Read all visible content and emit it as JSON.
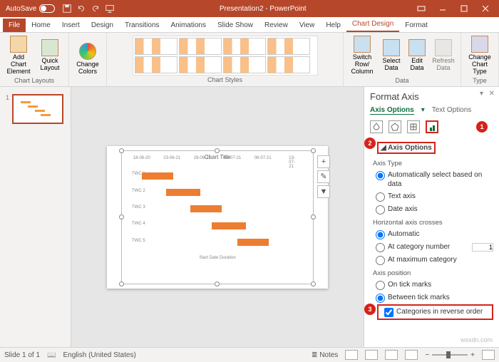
{
  "titlebar": {
    "autosave": "AutoSave",
    "title": "Presentation2 - PowerPoint"
  },
  "tabs": {
    "file": "File",
    "home": "Home",
    "insert": "Insert",
    "design": "Design",
    "transitions": "Transitions",
    "animations": "Animations",
    "slideshow": "Slide Show",
    "review": "Review",
    "view": "View",
    "help": "Help",
    "chartdesign": "Chart Design",
    "format": "Format"
  },
  "ribbon": {
    "layouts": {
      "addel": "Add Chart Element",
      "quick": "Quick Layout",
      "group": "Chart Layouts"
    },
    "colors": {
      "label": "Change Colors"
    },
    "styles_group": "Chart Styles",
    "data": {
      "switch": "Switch Row/ Column",
      "select": "Select Data",
      "edit": "Edit Data",
      "refresh": "Refresh Data",
      "group": "Data"
    },
    "type": {
      "change": "Change Chart Type",
      "group": "Type"
    }
  },
  "chart": {
    "title": "Chart Title",
    "legend": "Start Date   Duration"
  },
  "chart_data": {
    "type": "bar",
    "orientation": "horizontal",
    "categories": [
      "TWC 1",
      "TWC 2",
      "TWC 3",
      "TWC 4",
      "TWC 5"
    ],
    "x_ticks": [
      "18-06-20",
      "23-06-21",
      "28-06-21",
      "03-07-21",
      "08-07-21",
      "13-07-21"
    ],
    "bars": [
      {
        "left": 12,
        "width": 44
      },
      {
        "left": 46,
        "width": 48
      },
      {
        "left": 80,
        "width": 44
      },
      {
        "left": 110,
        "width": 48
      },
      {
        "left": 146,
        "width": 44
      }
    ],
    "title": "Chart Title"
  },
  "pane": {
    "title": "Format Axis",
    "tab1": "Axis Options",
    "tab2": "Text Options",
    "axis_options": "Axis Options",
    "axis_type": "Axis Type",
    "auto": "Automatically select based on data",
    "text_axis": "Text axis",
    "date_axis": "Date axis",
    "h_crosses": "Horizontal axis crosses",
    "automatic": "Automatic",
    "at_cat": "At category number",
    "at_max": "At maximum category",
    "cat_num_val": "1",
    "axis_pos": "Axis position",
    "on_tick": "On tick marks",
    "between": "Between tick marks",
    "reverse": "Categories in reverse order"
  },
  "callouts": {
    "c1": "1",
    "c2": "2",
    "c3": "3"
  },
  "status": {
    "slide": "Slide 1 of 1",
    "lang": "English (United States)",
    "notes": "Notes"
  },
  "watermark": "wsxdn.com"
}
